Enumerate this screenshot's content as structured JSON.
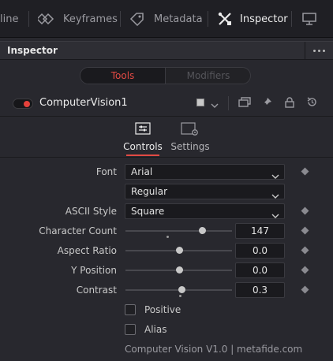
{
  "toolbar": {
    "items": [
      {
        "label": "line",
        "icon": "timeline-icon"
      },
      {
        "label": "Keyframes",
        "icon": "keyframes-icon"
      },
      {
        "label": "Metadata",
        "icon": "metadata-tag-icon"
      },
      {
        "label": "Inspector",
        "icon": "inspector-tools-icon",
        "active": true
      },
      {
        "label": "",
        "icon": "monitor-icon"
      }
    ]
  },
  "panel": {
    "title": "Inspector"
  },
  "segmented": {
    "tools_label": "Tools",
    "modifiers_label": "Modifiers",
    "active": "Tools"
  },
  "node": {
    "name": "ComputerVision1",
    "enabled": true,
    "accent_color": "#e5413b"
  },
  "tabs": {
    "controls_label": "Controls",
    "settings_label": "Settings",
    "active": "Controls"
  },
  "controls": {
    "font": {
      "label": "Font",
      "value": "Arial"
    },
    "style": {
      "value": "Regular"
    },
    "ascii_style": {
      "label": "ASCII Style",
      "value": "Square"
    },
    "character_count": {
      "label": "Character Count",
      "value": "147"
    },
    "aspect_ratio": {
      "label": "Aspect Ratio",
      "value": "0.0"
    },
    "y_position": {
      "label": "Y Position",
      "value": "0.0"
    },
    "contrast": {
      "label": "Contrast",
      "value": "0.3"
    },
    "positive": {
      "label": "Positive",
      "checked": false
    },
    "alias": {
      "label": "Alias",
      "checked": false
    }
  },
  "footer": {
    "credit": "Computer Vision V1.0 | metafide.com"
  },
  "colors": {
    "accent_red": "#e24a44",
    "background": "#28282e"
  }
}
